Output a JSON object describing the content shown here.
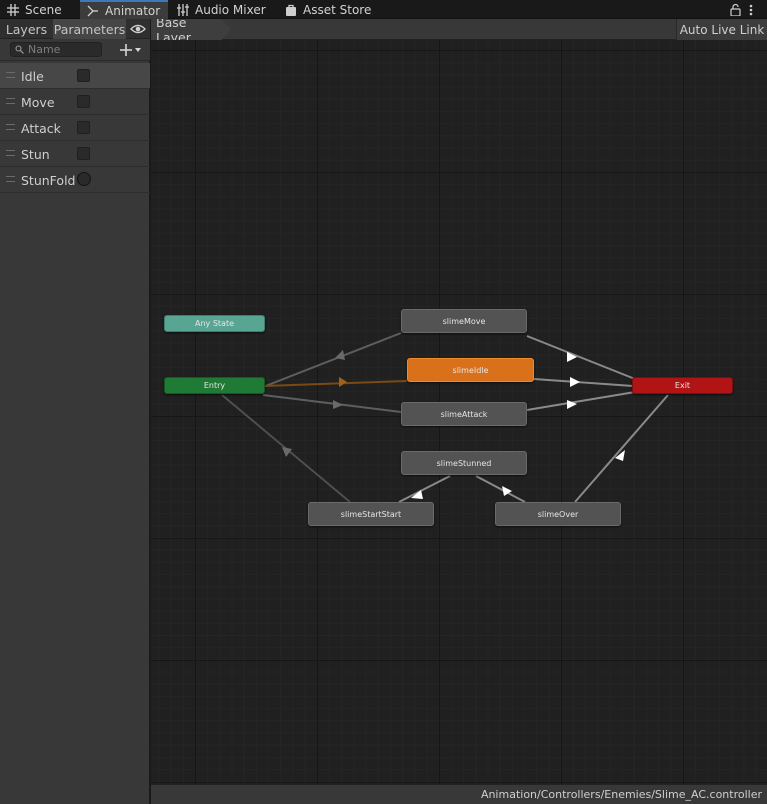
{
  "tabs": [
    {
      "label": "Scene",
      "icon": "grid-icon"
    },
    {
      "label": "Animator",
      "icon": "animator-icon",
      "active": true
    },
    {
      "label": "Audio Mixer",
      "icon": "mixer-icon"
    },
    {
      "label": "Asset Store",
      "icon": "bag-icon"
    }
  ],
  "left_panel": {
    "tabs": [
      "Layers",
      "Parameters"
    ],
    "search_placeholder": "Name",
    "parameters": [
      {
        "name": "Idle",
        "type": "bool"
      },
      {
        "name": "Move",
        "type": "bool"
      },
      {
        "name": "Attack",
        "type": "bool"
      },
      {
        "name": "Stun",
        "type": "bool"
      },
      {
        "name": "StunFold",
        "type": "trigger"
      }
    ]
  },
  "graph_header": {
    "breadcrumb": "Base Layer",
    "live_link": "Auto Live Link"
  },
  "colors": {
    "any_state": "#58a593",
    "entry": "#1f7a35",
    "default_state": "#d9711a",
    "state": "#535353",
    "exit": "#b11414",
    "transition": "#8c8c8c",
    "active_transition": "#a05d14"
  },
  "states": {
    "any_state": "Any State",
    "entry": "Entry",
    "exit": "Exit",
    "slime_move": "slimeMove",
    "slime_idle": "slimeIdle",
    "slime_attack": "slimeAttack",
    "slime_stunned": "slimeStunned",
    "slime_start_start": "slimeStartStart",
    "slime_over": "slimeOver"
  },
  "status": {
    "asset_path": "Animation/Controllers/Enemies/Slime_AC.controller"
  }
}
